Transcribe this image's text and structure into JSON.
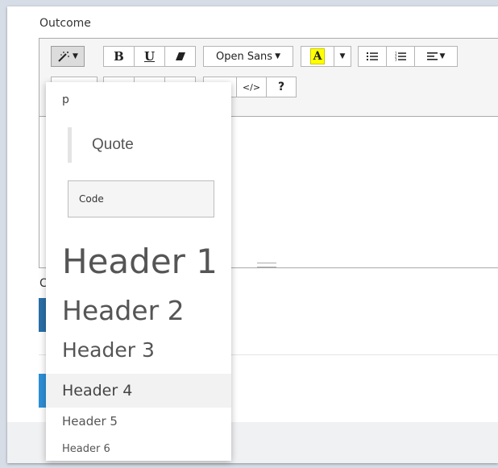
{
  "labels": {
    "outcome": "Outcome",
    "partial_label_char": "C"
  },
  "toolbar": {
    "style_icon": "magic-wand-icon",
    "bold": "B",
    "underline": "U",
    "eraser_icon": "eraser-icon",
    "font_name": "Open Sans",
    "highlight": "A",
    "unordered_list_icon": "bullet-list-icon",
    "ordered_list_icon": "numbered-list-icon",
    "align_icon": "align-icon",
    "code_view": "</>",
    "help": "?"
  },
  "style_menu": {
    "items": {
      "p": "p",
      "quote": "Quote",
      "code": "Code",
      "h1": "Header 1",
      "h2": "Header 2",
      "h3": "Header 3",
      "h4": "Header 4",
      "h5": "Header 5",
      "h6": "Header 6"
    },
    "hovered": "Header 4"
  },
  "colors": {
    "accent_dark": "#2a6fa8",
    "accent_light": "#2d8fd6",
    "highlight": "#ffff00"
  }
}
